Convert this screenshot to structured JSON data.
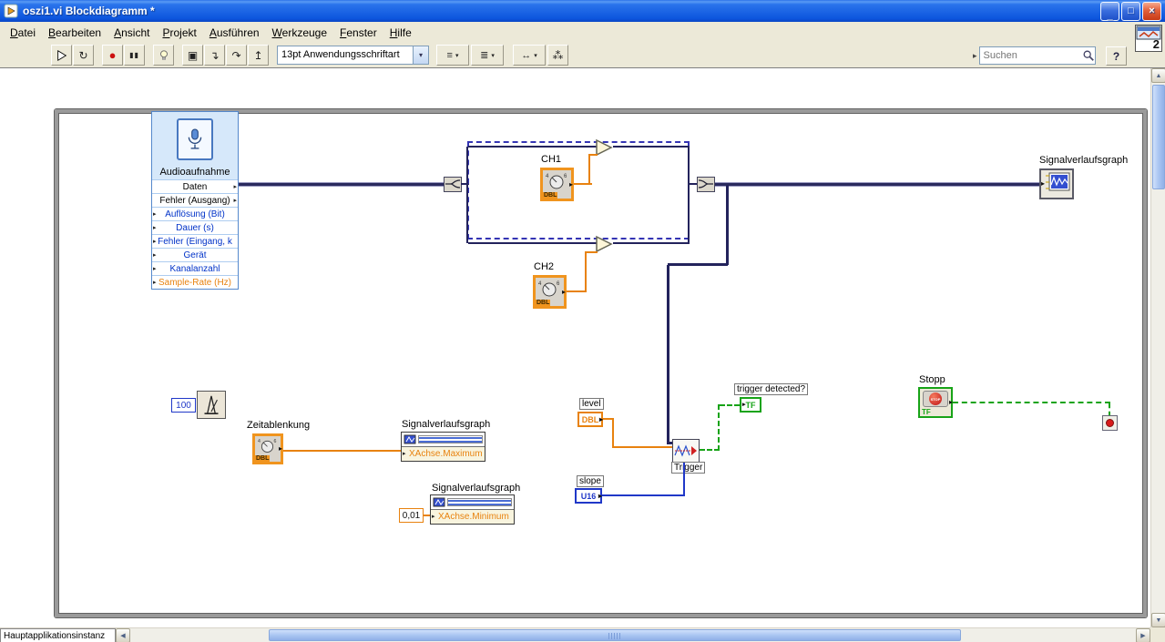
{
  "window": {
    "title": "oszi1.vi Blockdiagramm *",
    "controls": {
      "minimize": "_",
      "maximize": "□",
      "close": "×"
    }
  },
  "menu": {
    "items": [
      "Datei",
      "Bearbeiten",
      "Ansicht",
      "Projekt",
      "Ausführen",
      "Werkzeuge",
      "Fenster",
      "Hilfe"
    ]
  },
  "toolbar": {
    "run": "▷",
    "run_continuous": "↻",
    "abort": "●",
    "pause": "▮▮",
    "retain": "▣",
    "step_into": "↴",
    "step_over": "↷",
    "step_out": "↥",
    "font_selector": "13pt Anwendungsschriftart",
    "align": "≡",
    "distribute": "≣",
    "resize": "↔",
    "cleanup": "⁂",
    "dropdown_caret": "▾",
    "search_placeholder": "Suchen",
    "help": "?"
  },
  "vi_icon_number": "2",
  "statusbar": {
    "context": "Hauptapplikationsinstanz"
  },
  "diagram": {
    "audio": {
      "title": "Audioaufnahme",
      "rows": [
        "Daten",
        "Fehler (Ausgang)",
        "Auflösung (Bit)",
        "Dauer (s)",
        "Fehler (Eingang, k",
        "Gerät",
        "Kanalanzahl",
        "Sample-Rate (Hz)"
      ]
    },
    "ch1": {
      "label": "CH1",
      "type": "DBL"
    },
    "ch2": {
      "label": "CH2",
      "type": "DBL"
    },
    "zeitablenkung": {
      "label": "Zeitablenkung",
      "type": "DBL"
    },
    "wait_constant": "100",
    "min_constant": "0,01",
    "graph": {
      "label": "Signalverlaufsgraph"
    },
    "prop_max": {
      "label": "Signalverlaufsgraph",
      "property": "XAchse.Maximum"
    },
    "prop_min": {
      "label": "Signalverlaufsgraph",
      "property": "XAchse.Minimum"
    },
    "level": {
      "label": "level",
      "type": "DBL"
    },
    "slope": {
      "label": "slope",
      "type": "U16"
    },
    "trigger": {
      "label": "Trigger"
    },
    "trigger_detected": {
      "label": "trigger detected?",
      "type": "TF"
    },
    "stop": {
      "label": "Stopp",
      "type": "TF",
      "button_text": "STOP"
    }
  },
  "colors": {
    "titlebar_accent": "#0d55dd",
    "wire_dynamic": "#2a2a5e",
    "wire_double": "#e8820f",
    "wire_integer": "#2038c8",
    "wire_boolean": "#17a317"
  }
}
